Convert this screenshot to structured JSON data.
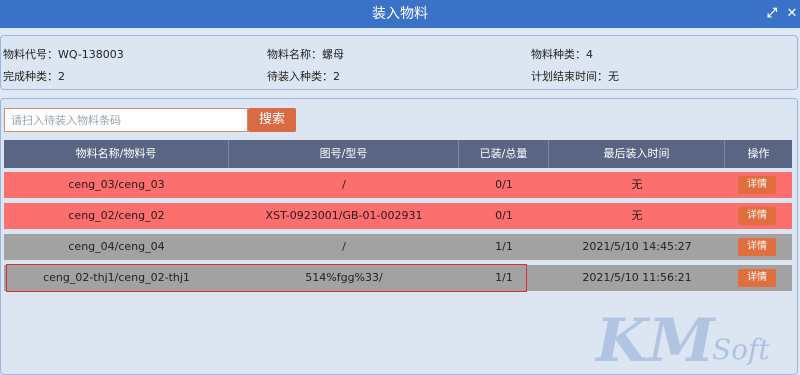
{
  "window": {
    "title": "装入物料"
  },
  "info": {
    "code": "物料代号：WQ-138003",
    "name": "物料名称：螺母",
    "kinds": "物料种类：4",
    "done": "完成种类：2",
    "pending": "待装入种类：2",
    "plan_end": "计划结束时间：无"
  },
  "search": {
    "placeholder": "请扫入待装入物料条码",
    "button_label": "搜索"
  },
  "table": {
    "columns": [
      "物料名称/物料号",
      "图号/型号",
      "已装/总量",
      "最后装入时间",
      "操作"
    ],
    "rows": [
      {
        "name": "ceng_03/ceng_03",
        "model": "/",
        "qty": "0/1",
        "time": "无",
        "action": "详情",
        "status_color": "#fb6f6f"
      },
      {
        "name": "ceng_02/ceng_02",
        "model": "XST-0923001/GB-01-002931",
        "qty": "0/1",
        "time": "无",
        "action": "详情",
        "status_color": "#fb6f6f"
      },
      {
        "name": "ceng_04/ceng_04",
        "model": "/",
        "qty": "1/1",
        "time": "2021/5/10 14:45:27",
        "action": "详情",
        "status_color": "#a2a2a2"
      },
      {
        "name": "ceng_02-thj1/ceng_02-thj1",
        "model": "514%fgg%33/",
        "qty": "1/1",
        "time": "2021/5/10 11:56:21",
        "action": "详情",
        "status_color": "#a2a2a2"
      }
    ]
  },
  "watermark": {
    "letters": "KM",
    "text": "Soft"
  },
  "colors": {
    "titlebar": "#3a72c8",
    "table_header": "#596583",
    "pending_row": "#fb6f6f",
    "done_row": "#a2a2a2",
    "accent_button": "#d96a44",
    "highlight_border": "#e02c2c"
  }
}
